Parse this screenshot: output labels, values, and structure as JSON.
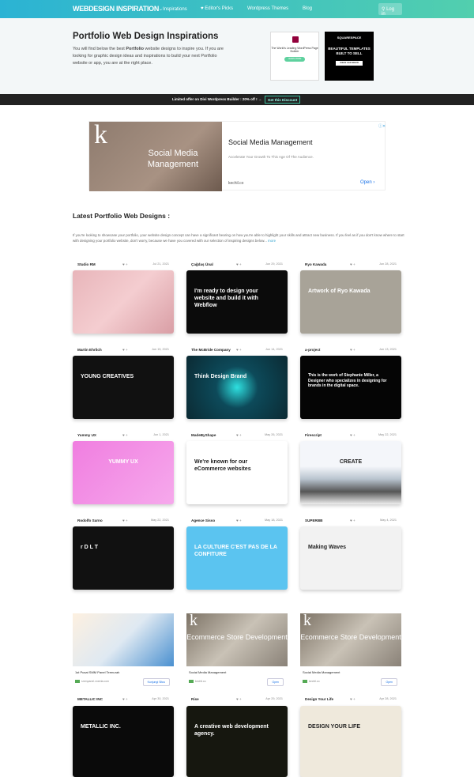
{
  "nav": {
    "logo": "WEBDESIGN INSPIRATION",
    "items": [
      "⌄Inspirations",
      "♥ Editor's Picks",
      "Wordpress Themes",
      "Blog"
    ],
    "login": "Log in"
  },
  "hero": {
    "title": "Portfolio Web Design Inspirations",
    "text_before": "You will find below the best ",
    "bold": "Portfolio",
    "text_after": " website designs to inspire you. If you are looking for graphic design ideas and inspirations to build your next Portfolio website or app, you are at the right place.",
    "ad1": {
      "text": "The World's Leading WordPress Page Builder",
      "button": "LEARN MORE"
    },
    "ad2": {
      "brand": "SQUARESPACE",
      "text": "BEAUTIFUL TEMPLATES BUILT TO SELL",
      "button": "CREATE YOUR WEBSITE"
    }
  },
  "promo": {
    "text": "Limited offer on Divi Wordpress Builder : 20% off ! →",
    "button": "Get this Discount"
  },
  "big_ad": {
    "image_text": "Social Media Management",
    "headline": "Social Media Management",
    "sub": "Accelerate Your Growth To This Age Of The Audience.",
    "url": "kechil.co",
    "open": "Open ›"
  },
  "latest": {
    "title": "Latest Portfolio Web Designs :",
    "intro": "If you're looking to showcase your portfolio, your website design concept can have a significant bearing on how you're able to highlight your skills and attract new business. If you feel as if you don't know where to start with designing your portfolio website, don't worry, because we have you covered with our selection of inspiring designs below... ",
    "more": "more"
  },
  "cards": [
    {
      "name": "Studio RM",
      "date": "Jul 21, 2021",
      "bg": "linear-gradient(135deg,#e8b5ba,#f4cdd0 50%,#d99ea5)",
      "text": ""
    },
    {
      "name": "Çağdaş Ünal",
      "date": "Jun 29, 2021",
      "bg": "#0b0b0b",
      "text": "I'm ready to design your website and build it with Webflow"
    },
    {
      "name": "Ryo Kawada",
      "date": "Jun 28, 2021",
      "bg": "#a8a398",
      "text": "Artwork of Ryo Kawada"
    },
    {
      "name": "Martin Ehrlich",
      "date": "Jun 15, 2021",
      "bg": "#111",
      "text": "YOUNG CREATIVES"
    },
    {
      "name": "The McBride Company",
      "date": "Jun 14, 2021",
      "bg": "radial-gradient(circle at 50% 50%,#2ee0e0,#0d4a5a 35%,#0b2a33)",
      "text": "Think   Design   Brand"
    },
    {
      "name": "a-project",
      "date": "Jun 13, 2021",
      "bg": "#050505",
      "text": "This is the work of Stephanie Miller, a Designer who specializes in designing for brands in the digital space."
    },
    {
      "name": "Yummy UX",
      "date": "Jun 1, 2021",
      "bg": "linear-gradient(135deg,#f07ee0,#f6a9ec)",
      "text": "YUMMY UX"
    },
    {
      "name": "MadeByShape",
      "date": "May 26, 2021",
      "bg": "#fff",
      "text": "We're known for our eCommerce websites"
    },
    {
      "name": "Firescript",
      "date": "May 22, 2021",
      "bg": "linear-gradient(180deg,#f4f6fa 40%,#b9c4cf 60%,#555 80%,#eee)",
      "text": "CREATE"
    },
    {
      "name": "Rodolfo Sarno",
      "date": "May 22, 2021",
      "bg": "#111",
      "text": "r   D   L   T"
    },
    {
      "name": "Agence Sisso",
      "date": "May 18, 2021",
      "bg": "#5bc4f0",
      "text": "LA CULTURE C'EST PAS DE LA CONFITURE"
    },
    {
      "name": "SUPERBB",
      "date": "May 4, 2021",
      "bg": "#f2f2f2",
      "text": "Making Waves"
    },
    {
      "name": "METALLIC INC",
      "date": "Apr 30, 2021",
      "bg": "#0a0a0a",
      "text": "METALLIC INC."
    },
    {
      "name": "Rise",
      "date": "Apr 29, 2021",
      "bg": "#16170f",
      "text": "A creative web development agency."
    },
    {
      "name": "Design Your Life",
      "date": "Apr 28, 2021",
      "bg": "#efe9dc",
      "text": "DESIGN YOUR LIFE"
    }
  ],
  "ads": [
    {
      "title": "1st Pusat SMM Panel Termurah",
      "url": "smmpanel.xneela.com",
      "button": "Kunjungi Situs",
      "image_text": ""
    },
    {
      "title": "Social Media Management",
      "url": "kechil.co",
      "button": "Open",
      "image_text": "Ecommerce Store Development"
    },
    {
      "title": "Social Media Management",
      "url": "kechil.co",
      "button": "Open",
      "image_text": "Ecommerce Store Development"
    }
  ]
}
